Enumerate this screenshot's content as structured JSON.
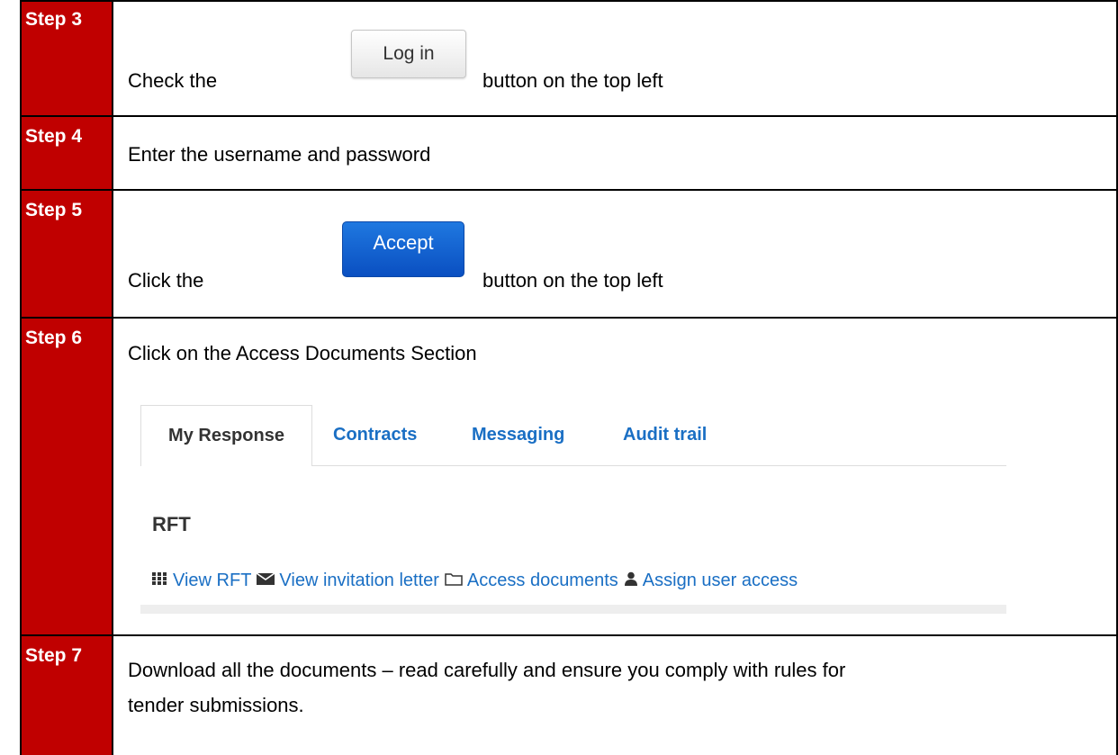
{
  "steps": [
    {
      "label": "Step 3",
      "text_before": "Check the",
      "button": "Log in",
      "text_after": "button on the top left"
    },
    {
      "label": "Step 4",
      "text": "Enter the username and password"
    },
    {
      "label": "Step 5",
      "text_before": "Click the",
      "button": "Accept",
      "text_after": "button on the top left"
    },
    {
      "label": "Step 6",
      "text": "Click on the Access Documents Section"
    },
    {
      "label": "Step 7",
      "line1": "Download all the documents – read carefully and ensure you comply with rules for",
      "line2": "tender submissions."
    }
  ],
  "panel": {
    "tabs": [
      "My Response",
      "Contracts",
      "Messaging",
      "Audit trail"
    ],
    "title": "RFT",
    "links": [
      "View RFT",
      "View invitation letter",
      "Access documents",
      "Assign user access"
    ],
    "icons": [
      "grid-icon",
      "envelope-icon",
      "folder-icon",
      "user-icon"
    ]
  },
  "colors": {
    "step_bg": "#c00000",
    "link": "#1a6fc4",
    "accept_button": "#0a4fc1"
  }
}
